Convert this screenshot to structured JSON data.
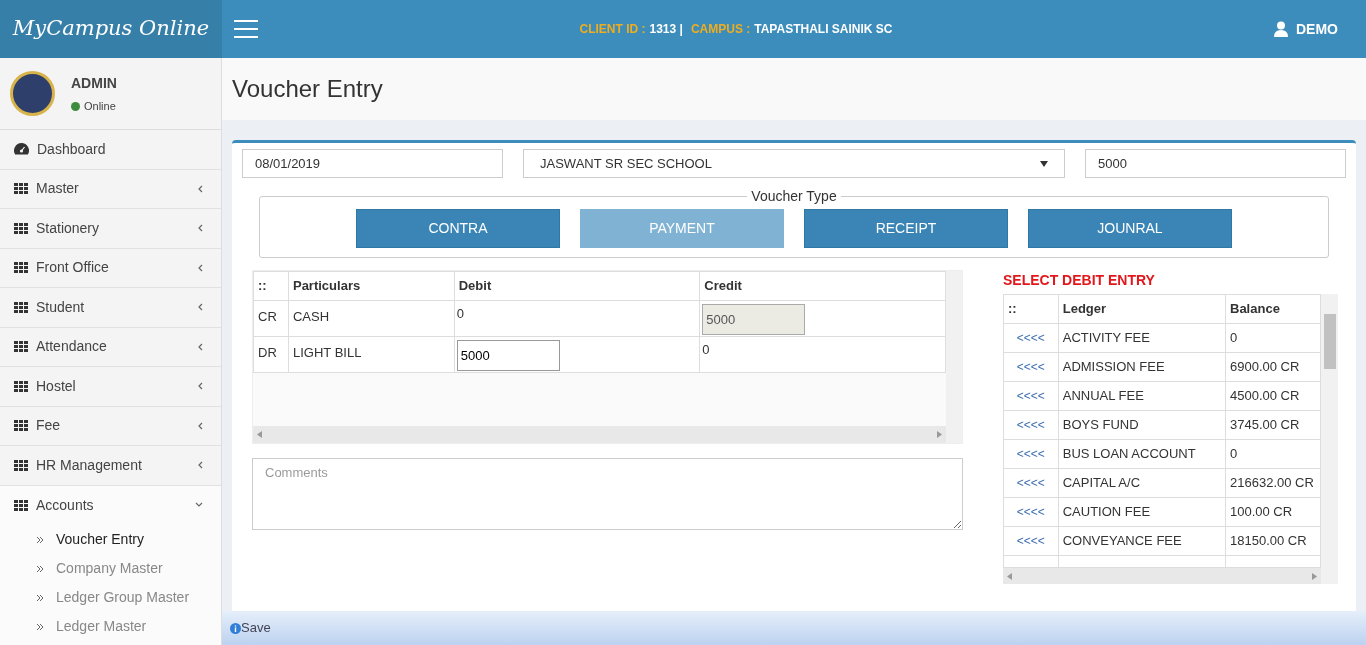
{
  "brand": "MyCampus Online",
  "header": {
    "client_id_label": "CLIENT ID :",
    "client_id": "1313 |",
    "campus_label": "CAMPUS :",
    "campus": "TAPASTHALI SAINIK SC",
    "user": "DEMO"
  },
  "user_panel": {
    "name": "ADMIN",
    "status": "Online"
  },
  "sidebar": {
    "items": [
      {
        "label": "Dashboard",
        "kind": "link"
      },
      {
        "label": "Master",
        "kind": "menu",
        "expanded": false
      },
      {
        "label": "Stationery",
        "kind": "menu",
        "expanded": false
      },
      {
        "label": "Front Office",
        "kind": "menu",
        "expanded": false
      },
      {
        "label": "Student",
        "kind": "menu",
        "expanded": false
      },
      {
        "label": "Attendance",
        "kind": "menu",
        "expanded": false
      },
      {
        "label": "Hostel",
        "kind": "menu",
        "expanded": false
      },
      {
        "label": "Fee",
        "kind": "menu",
        "expanded": false
      },
      {
        "label": "HR Management",
        "kind": "menu",
        "expanded": false
      },
      {
        "label": "Accounts",
        "kind": "menu",
        "expanded": true,
        "children": [
          {
            "label": "Voucher Entry",
            "selected": true
          },
          {
            "label": "Company Master",
            "selected": false
          },
          {
            "label": "Ledger Group Master",
            "selected": false
          },
          {
            "label": "Ledger Master",
            "selected": false
          }
        ]
      }
    ]
  },
  "page_title": "Voucher Entry",
  "form": {
    "date": "08/01/2019",
    "school": "JASWANT SR SEC SCHOOL",
    "amount": "5000"
  },
  "voucher_type": {
    "legend": "Voucher Type",
    "buttons": [
      {
        "label": "CONTRA",
        "selected": false
      },
      {
        "label": "PAYMENT",
        "selected": true
      },
      {
        "label": "RECEIPT",
        "selected": false
      },
      {
        "label": "JOUNRAL",
        "selected": false
      }
    ]
  },
  "entry_table": {
    "columns": [
      "::",
      "Particulars",
      "Debit",
      "Credit"
    ],
    "rows": [
      {
        "type": "CR",
        "particular": "CASH",
        "debit": {
          "kind": "text",
          "value": "0"
        },
        "credit": {
          "kind": "readonly",
          "value": "5000"
        }
      },
      {
        "type": "DR",
        "particular": "LIGHT BILL",
        "debit": {
          "kind": "input",
          "value": "5000"
        },
        "credit": {
          "kind": "text",
          "value": "0"
        }
      }
    ]
  },
  "comments": {
    "placeholder": "Comments"
  },
  "ledger_panel": {
    "title": "SELECT DEBIT ENTRY",
    "columns": [
      "::",
      "Ledger",
      "Balance"
    ],
    "rows": [
      {
        "action": "<<<<",
        "ledger": "ACTIVITY FEE",
        "balance": "0"
      },
      {
        "action": "<<<<",
        "ledger": "ADMISSION FEE",
        "balance": "6900.00 CR"
      },
      {
        "action": "<<<<",
        "ledger": "ANNUAL FEE",
        "balance": "4500.00 CR"
      },
      {
        "action": "<<<<",
        "ledger": "BOYS FUND",
        "balance": "3745.00 CR"
      },
      {
        "action": "<<<<",
        "ledger": "BUS LOAN ACCOUNT",
        "balance": "0"
      },
      {
        "action": "<<<<",
        "ledger": "CAPITAL A/C",
        "balance": "216632.00 CR"
      },
      {
        "action": "<<<<",
        "ledger": "CAUTION FEE",
        "balance": "100.00 CR"
      },
      {
        "action": "<<<<",
        "ledger": "CONVEYANCE FEE",
        "balance": "18150.00 CR"
      }
    ]
  },
  "save_bar": {
    "label": "Save"
  }
}
